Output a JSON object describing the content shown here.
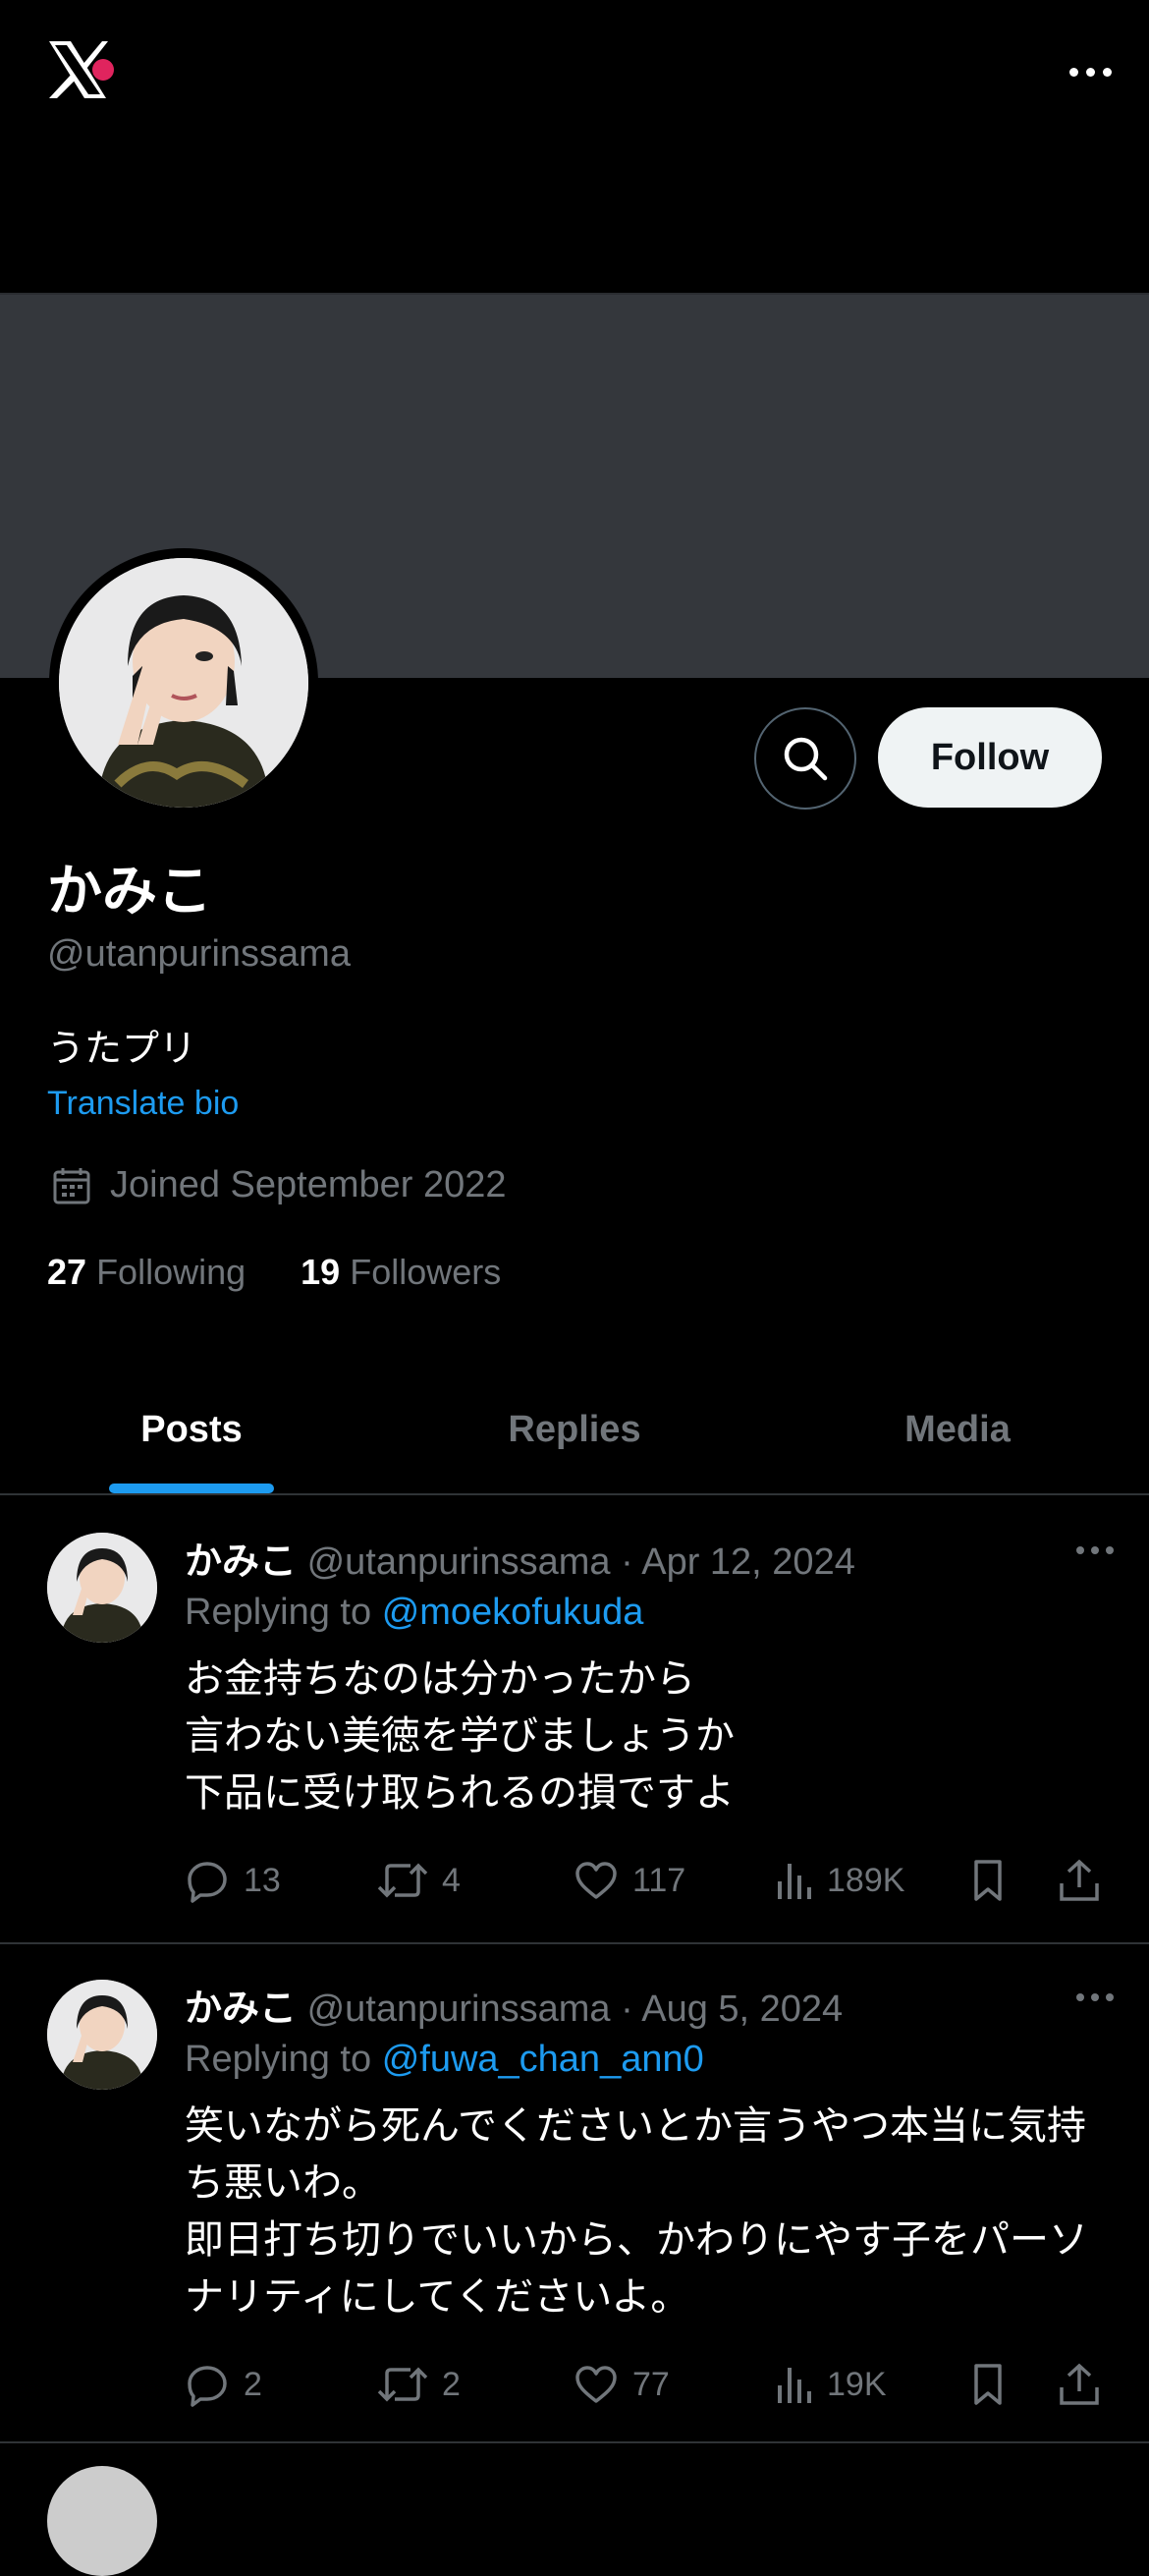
{
  "header": {
    "logo_icon": "x-logo-icon",
    "more_icon": "more-horizontal-icon"
  },
  "profile": {
    "name": "かみこ",
    "handle": "@utanpurinssama",
    "bio": "うたプリ",
    "translate_label": "Translate bio",
    "joined": "Joined September 2022",
    "following_count": "27",
    "following_label": "Following",
    "followers_count": "19",
    "followers_label": "Followers",
    "follow_button": "Follow"
  },
  "tabs": [
    {
      "label": "Posts",
      "active": true
    },
    {
      "label": "Replies",
      "active": false
    },
    {
      "label": "Media",
      "active": false
    }
  ],
  "posts": [
    {
      "name": "かみこ",
      "handle": "@utanpurinssama",
      "date": "· Apr 12, 2024",
      "replying_prefix": "Replying to",
      "replying_to": "@moekofukuda",
      "text": "お金持ちなのは分かったから\n言わない美徳を学びましょうか\n下品に受け取られるの損ですよ",
      "replies": "13",
      "reposts": "4",
      "likes": "117",
      "views": "189K"
    },
    {
      "name": "かみこ",
      "handle": "@utanpurinssama",
      "date": "· Aug 5, 2024",
      "replying_prefix": "Replying to",
      "replying_to": "@fuwa_chan_ann0",
      "text": "笑いながら死んでくださいとか言うやつ本当に気持ち悪いわ。\n即日打ち切りでいいから、かわりにやす子をパーソナリティにしてくださいよ。",
      "replies": "2",
      "reposts": "2",
      "likes": "77",
      "views": "19K"
    }
  ],
  "colors": {
    "accent": "#1d9bf0",
    "banner": "#34373c",
    "muted": "#71767b"
  }
}
